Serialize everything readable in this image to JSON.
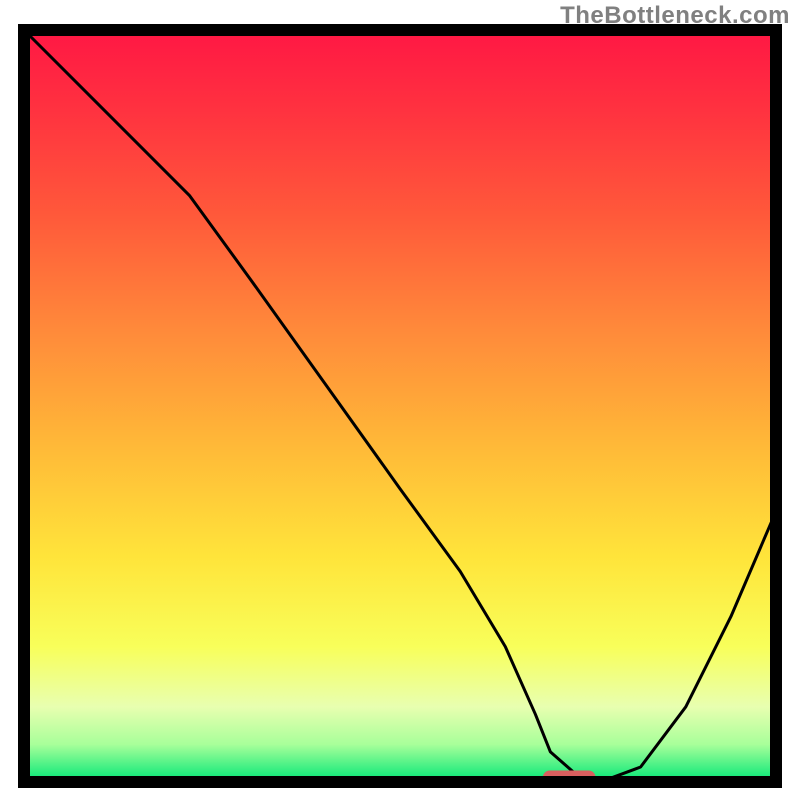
{
  "watermark": "TheBottleneck.com",
  "chart_data": {
    "type": "line",
    "title": "",
    "xlabel": "",
    "ylabel": "",
    "xlim": [
      0,
      100
    ],
    "ylim": [
      0,
      100
    ],
    "x": [
      0,
      10,
      22,
      30,
      40,
      50,
      58,
      64,
      68,
      70,
      74,
      78,
      82,
      88,
      94,
      100
    ],
    "values": [
      100,
      90,
      78,
      67,
      53,
      39,
      28,
      18,
      9,
      4,
      0.5,
      0.5,
      2,
      10,
      22,
      36
    ],
    "marker": {
      "x_start": 69,
      "x_end": 76,
      "y": 0.6
    },
    "gradient_stops": [
      {
        "offset": 0.0,
        "color": "#ff1744"
      },
      {
        "offset": 0.1,
        "color": "#ff3040"
      },
      {
        "offset": 0.25,
        "color": "#ff5a3a"
      },
      {
        "offset": 0.4,
        "color": "#ff8a3a"
      },
      {
        "offset": 0.55,
        "color": "#ffb838"
      },
      {
        "offset": 0.7,
        "color": "#ffe43a"
      },
      {
        "offset": 0.82,
        "color": "#f8ff5a"
      },
      {
        "offset": 0.9,
        "color": "#e8ffb0"
      },
      {
        "offset": 0.95,
        "color": "#a8ff9a"
      },
      {
        "offset": 1.0,
        "color": "#00e676"
      }
    ],
    "marker_color": "#d95f5f",
    "line_color": "#000000",
    "frame_color": "#000000"
  }
}
